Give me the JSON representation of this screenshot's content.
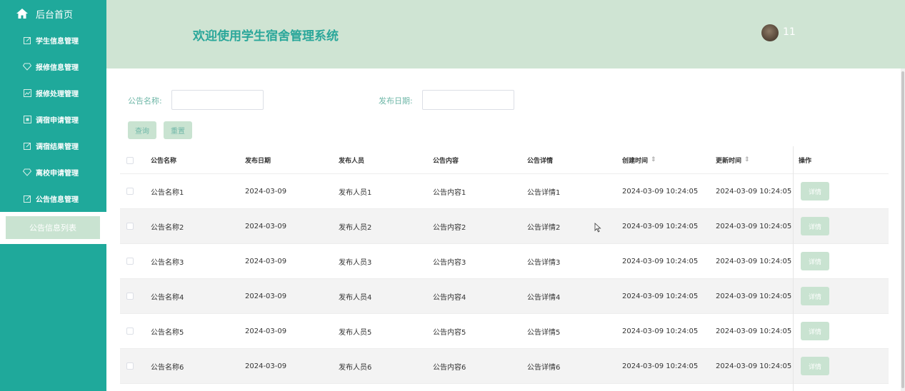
{
  "sidebar": {
    "home_label": "后台首页",
    "items": [
      {
        "label": "学生信息管理",
        "icon": "edit-icon"
      },
      {
        "label": "报修信息管理",
        "icon": "diamond-icon"
      },
      {
        "label": "报修处理管理",
        "icon": "chart-icon"
      },
      {
        "label": "调宿申请管理",
        "icon": "list-icon"
      },
      {
        "label": "调宿结果管理",
        "icon": "edit-icon"
      },
      {
        "label": "离校申请管理",
        "icon": "diamond-icon"
      },
      {
        "label": "公告信息管理",
        "icon": "edit-icon"
      }
    ],
    "active_sub": "公告信息列表"
  },
  "header": {
    "title": "欢迎使用学生宿舍管理系统",
    "username": "11"
  },
  "search": {
    "name_label": "公告名称:",
    "name_value": "",
    "date_label": "发布日期:",
    "date_value": "",
    "query_label": "查询",
    "reset_label": "重置"
  },
  "table": {
    "columns": [
      "公告名称",
      "发布日期",
      "发布人员",
      "公告内容",
      "公告详情",
      "创建时间",
      "更新时间",
      "操作"
    ],
    "sort_icon": "⇕",
    "detail_label": "详情",
    "rows": [
      {
        "name": "公告名称1",
        "date": "2024-03-09",
        "publisher": "发布人员1",
        "content": "公告内容1",
        "detail": "公告详情1",
        "created": "2024-03-09 10:24:05",
        "updated": "2024-03-09 10:24:05"
      },
      {
        "name": "公告名称2",
        "date": "2024-03-09",
        "publisher": "发布人员2",
        "content": "公告内容2",
        "detail": "公告详情2",
        "created": "2024-03-09 10:24:05",
        "updated": "2024-03-09 10:24:05"
      },
      {
        "name": "公告名称3",
        "date": "2024-03-09",
        "publisher": "发布人员3",
        "content": "公告内容3",
        "detail": "公告详情3",
        "created": "2024-03-09 10:24:05",
        "updated": "2024-03-09 10:24:05"
      },
      {
        "name": "公告名称4",
        "date": "2024-03-09",
        "publisher": "发布人员4",
        "content": "公告内容4",
        "detail": "公告详情4",
        "created": "2024-03-09 10:24:05",
        "updated": "2024-03-09 10:24:05"
      },
      {
        "name": "公告名称5",
        "date": "2024-03-09",
        "publisher": "发布人员5",
        "content": "公告内容5",
        "detail": "公告详情5",
        "created": "2024-03-09 10:24:05",
        "updated": "2024-03-09 10:24:05"
      },
      {
        "name": "公告名称6",
        "date": "2024-03-09",
        "publisher": "发布人员6",
        "content": "公告内容6",
        "detail": "公告详情6",
        "created": "2024-03-09 10:24:05",
        "updated": "2024-03-09 10:24:05"
      }
    ]
  },
  "colors": {
    "sidebar": "#1fa99b",
    "header": "#cfe4d3",
    "accent": "#2aa79a",
    "button": "#c9e3d1"
  }
}
